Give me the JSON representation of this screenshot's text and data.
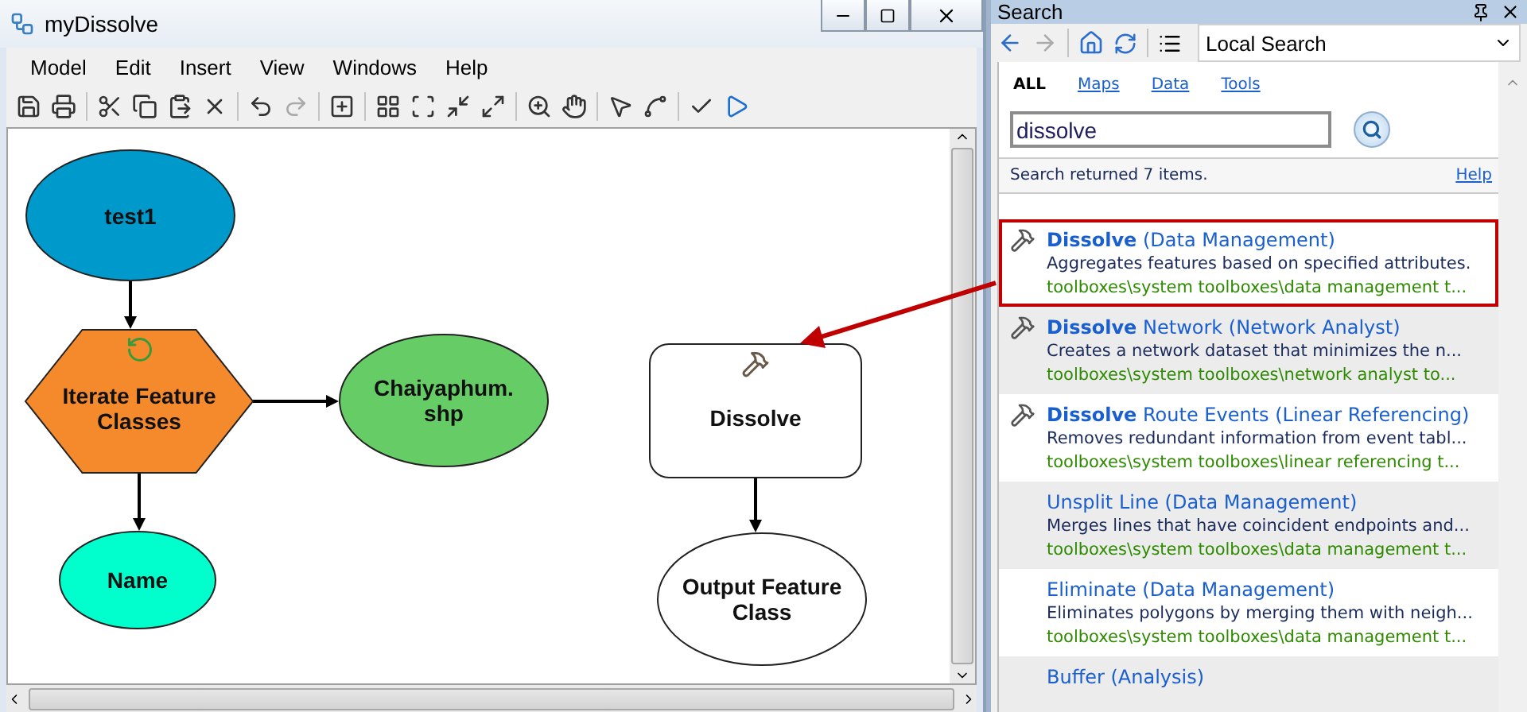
{
  "model_window": {
    "title": "myDissolve",
    "menu": [
      "Model",
      "Edit",
      "Insert",
      "View",
      "Windows",
      "Help"
    ],
    "nodes": [
      {
        "label": "test1",
        "kind": "ellipse",
        "color": "#0099cc"
      },
      {
        "label": "Iterate Feature Classes",
        "kind": "hexagon",
        "color": "#f58a2c"
      },
      {
        "label": "Chaiyaphum. shp",
        "kind": "ellipse",
        "color": "#66cc66"
      },
      {
        "label": "Name",
        "kind": "ellipse",
        "color": "#00ffcc"
      },
      {
        "label": "Dissolve",
        "kind": "tool",
        "color": "#ffffff"
      },
      {
        "label": "Output Feature Class",
        "kind": "ellipse",
        "color": "#ffffff"
      }
    ]
  },
  "search_panel": {
    "title": "Search",
    "scope": "Local Search",
    "tabs": [
      {
        "label": "ALL",
        "selected": true
      },
      {
        "label": "Maps",
        "selected": false
      },
      {
        "label": "Data",
        "selected": false
      },
      {
        "label": "Tools",
        "selected": false
      }
    ],
    "query": "dissolve",
    "status": "Search returned 7 items.",
    "help_link": "Help",
    "results": [
      {
        "title": "**Dissolve** (Data Management)",
        "description": "Aggregates features based on specified attributes.",
        "path": "toolboxes\\system toolboxes\\data management t...",
        "icon": true,
        "highlighted": true
      },
      {
        "title": "**Dissolve** Network (Network Analyst)",
        "description": "Creates a network dataset that minimizes the n...",
        "path": "toolboxes\\system toolboxes\\network analyst to...",
        "icon": true,
        "highlighted": false
      },
      {
        "title": "**Dissolve** Route Events (Linear Referencing)",
        "description": "Removes redundant information from event tabl...",
        "path": "toolboxes\\system toolboxes\\linear referencing t...",
        "icon": true,
        "highlighted": false
      },
      {
        "title": "Unsplit Line (Data Management)",
        "description": "Merges lines that have coincident endpoints and...",
        "path": "toolboxes\\system toolboxes\\data management t...",
        "icon": false,
        "highlighted": false
      },
      {
        "title": "Eliminate (Data Management)",
        "description": "Eliminates polygons by merging them with neigh...",
        "path": "toolboxes\\system toolboxes\\data management t...",
        "icon": false,
        "highlighted": false
      },
      {
        "title": "Buffer (Analysis)",
        "icon": false,
        "highlighted": false
      }
    ]
  }
}
